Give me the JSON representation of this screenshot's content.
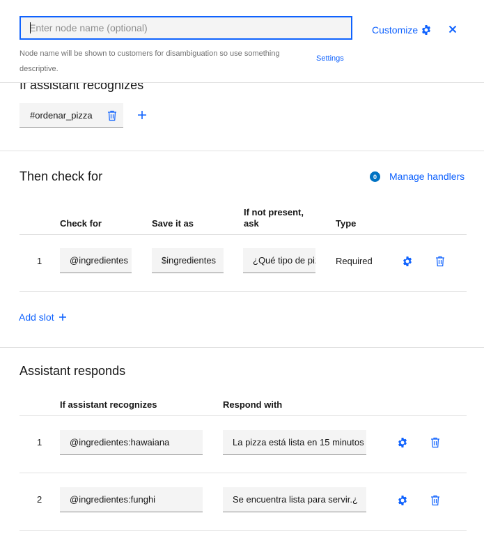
{
  "header": {
    "node_name_value": "",
    "node_name_placeholder": "Enter node name (optional)",
    "helper_text": "Node name will be shown to customers for disambiguation so use something descriptive.",
    "customize_label": "Customize",
    "settings_label": "Settings"
  },
  "condition": {
    "title": "If assistant recognizes",
    "intent": "#ordenar_pizza"
  },
  "slots": {
    "title": "Then check for",
    "handlers_count": "0",
    "manage_handlers_label": "Manage handlers",
    "columns": {
      "check_for": "Check for",
      "save_as": "Save it as",
      "if_not_present": "If not present, ask",
      "type": "Type"
    },
    "rows": [
      {
        "number": "1",
        "check_for": "@ingredientes",
        "save_as": "$ingredientes",
        "prompt": "¿Qué tipo de pizza desea?",
        "type": "Required"
      }
    ],
    "add_slot_label": "Add slot"
  },
  "responses": {
    "title": "Assistant responds",
    "columns": {
      "condition": "If assistant recognizes",
      "respond": "Respond with"
    },
    "rows": [
      {
        "number": "1",
        "condition": "@ingredientes:hawaiana",
        "response": "La pizza está lista en 15 minutos"
      },
      {
        "number": "2",
        "condition": "@ingredientes:funghi",
        "response": "Se encuentra lista para servir.¿"
      }
    ]
  },
  "colors": {
    "accent": "#0f62fe",
    "badge": "#0072c3",
    "field_bg": "#f4f4f4"
  }
}
